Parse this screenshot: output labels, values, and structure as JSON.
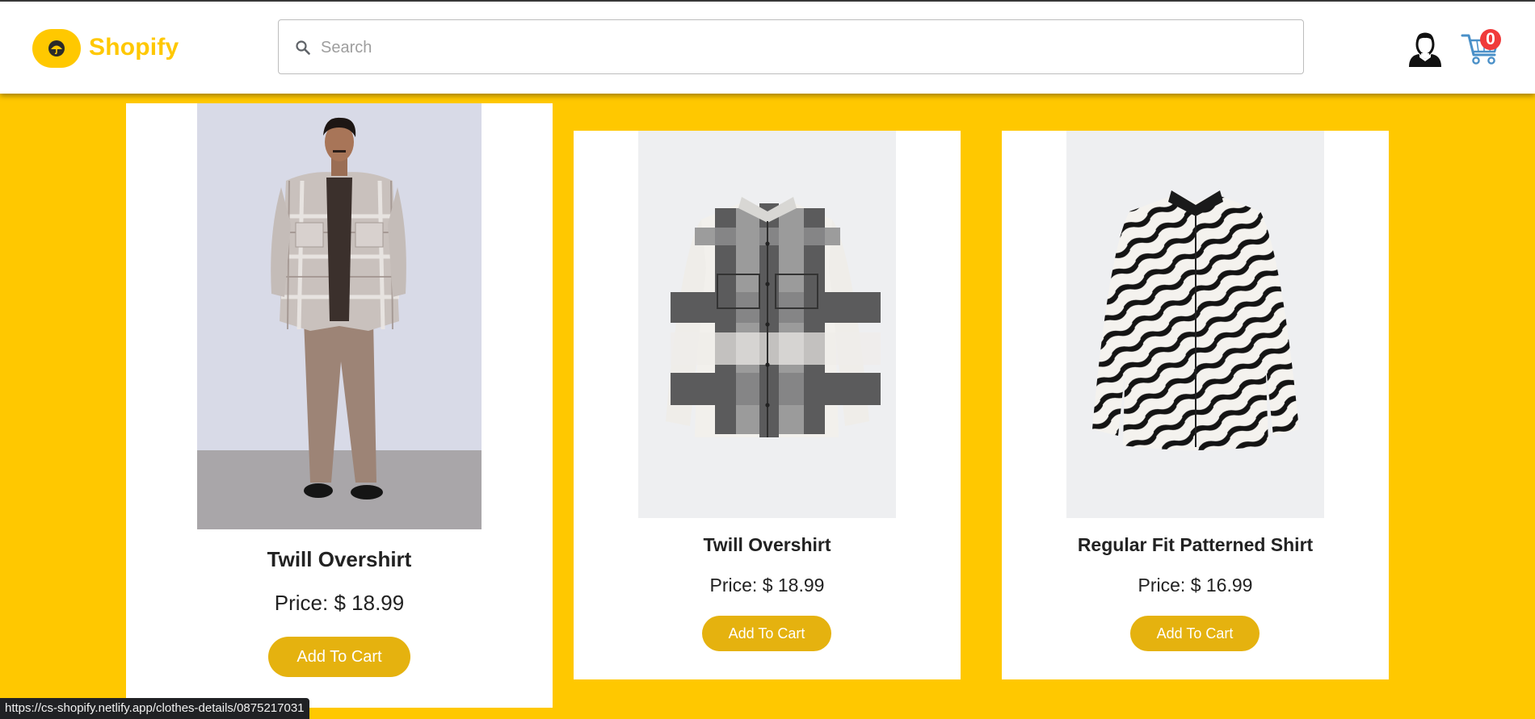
{
  "header": {
    "brand": "Shopify",
    "search_placeholder": "Search",
    "cart_count": "0",
    "icons": [
      "umbrella-logo-icon",
      "search-icon",
      "user-icon",
      "cart-icon"
    ],
    "accent_color": "#ffc800"
  },
  "products": [
    {
      "title": "Twill Overshirt",
      "price": "Price: $ 18.99",
      "button_label": "Add To Cart",
      "image": "model wearing beige checked overshirt with brown trousers",
      "hovered": true
    },
    {
      "title": "Twill Overshirt",
      "price": "Price: $ 18.99",
      "button_label": "Add To Cart",
      "image": "grey and white checked flannel overshirt"
    },
    {
      "title": "Regular Fit Patterned Shirt",
      "price": "Price: $ 16.99",
      "button_label": "Add To Cart",
      "image": "black and white zebra-print shirt"
    }
  ],
  "status_url": "https://cs-shopify.netlify.app/clothes-details/0875217031",
  "colors": {
    "background": "#ffc800",
    "button": "#e5b20f",
    "badge": "#f03a3a"
  }
}
